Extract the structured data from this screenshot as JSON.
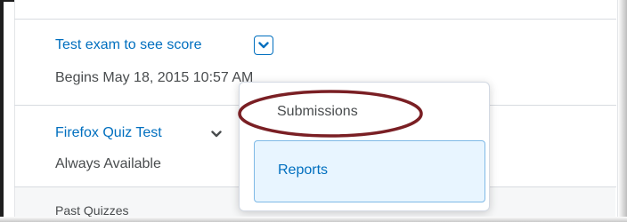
{
  "quizzes": [
    {
      "title": "Test exam to see score",
      "subtitle": "Begins May 18, 2015 10:57 AM"
    },
    {
      "title": "Firefox Quiz Test",
      "subtitle": "Always Available"
    }
  ],
  "past_section": {
    "label": "Past Quizzes"
  },
  "context_menu": {
    "items": [
      {
        "label": "Submissions"
      },
      {
        "label": "Reports"
      }
    ]
  },
  "colors": {
    "link": "#006fbf",
    "text": "#494c4e",
    "highlight_bg": "#e8f5ff",
    "highlight_border": "#7fb9e6",
    "annotation_ring": "#7a1f24"
  },
  "icons": {
    "dropdown": "chevron-down-icon"
  }
}
